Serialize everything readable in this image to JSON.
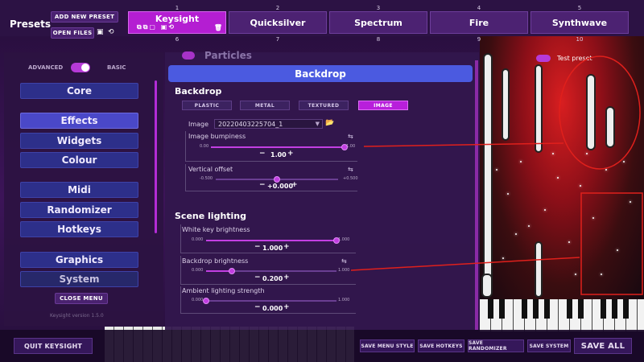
{
  "colors": {
    "accent": "#b41ed2",
    "menu_button": "#2d2f8a",
    "header_blue": "#4b5ae0",
    "annotation_red": "#e0201c"
  },
  "presets": {
    "title": "Presets",
    "add_new": "ADD NEW PRESET",
    "open_files": "OPEN FILES",
    "cards": [
      {
        "number": "1",
        "name": "Keysight",
        "active": true
      },
      {
        "number": "2",
        "name": "Quicksilver"
      },
      {
        "number": "3",
        "name": "Spectrum"
      },
      {
        "number": "4",
        "name": "Fire"
      },
      {
        "number": "5",
        "name": "Synthwave"
      }
    ],
    "second_row_numbers": [
      "6",
      "7",
      "8",
      "9",
      "10"
    ]
  },
  "menu": {
    "toggle_left": "ADVANCED",
    "toggle_right": "BASIC",
    "items": [
      "Core",
      "Effects",
      "Widgets",
      "Colour",
      "Midi",
      "Randomizer",
      "Hotkeys",
      "Graphics",
      "System"
    ],
    "selected": "Effects",
    "close": "CLOSE MENU",
    "version": "Keysight version 1.5.0"
  },
  "panel": {
    "particles": "Particles",
    "header": "Backdrop",
    "backdrop_title": "Backdrop",
    "tabs": [
      "PLASTIC",
      "METAL",
      "TEXTURED",
      "IMAGE"
    ],
    "selected_tab": "IMAGE",
    "image_label": "Image",
    "image_value": "20220403225704_1",
    "bumpiness": {
      "label": "Image bumpiness",
      "min": "0.00",
      "max": "1.00",
      "value": "1.00",
      "fraction": 1.0
    },
    "offset": {
      "label": "Vertical offset",
      "min": "-0.500",
      "max": "+0.500",
      "value": "+0.000",
      "fraction": 0.5
    },
    "scene_title": "Scene lighting",
    "white_key": {
      "label": "White key brightness",
      "min": "0.000",
      "max": "1.000",
      "value": "1.000",
      "fraction": 1.0
    },
    "backdrop_bright": {
      "label": "Backdrop brightness",
      "min": "0.000",
      "max": "1.000",
      "value": "0.200",
      "fraction": 0.2
    },
    "ambient": {
      "label": "Ambient lighting strength",
      "min": "0.000",
      "max": "1.000",
      "value": "0.000",
      "fraction": 0.0
    }
  },
  "test_preset": "Test preset",
  "bottom": {
    "quit": "QUIT KEYSIGHT",
    "save_menu_style": "SAVE MENU STYLE",
    "save_hotkeys": "SAVE HOTKEYS",
    "save_randomizer": "SAVE RANDOMIZER",
    "save_system": "SAVE SYSTEM",
    "save_all": "SAVE ALL"
  }
}
